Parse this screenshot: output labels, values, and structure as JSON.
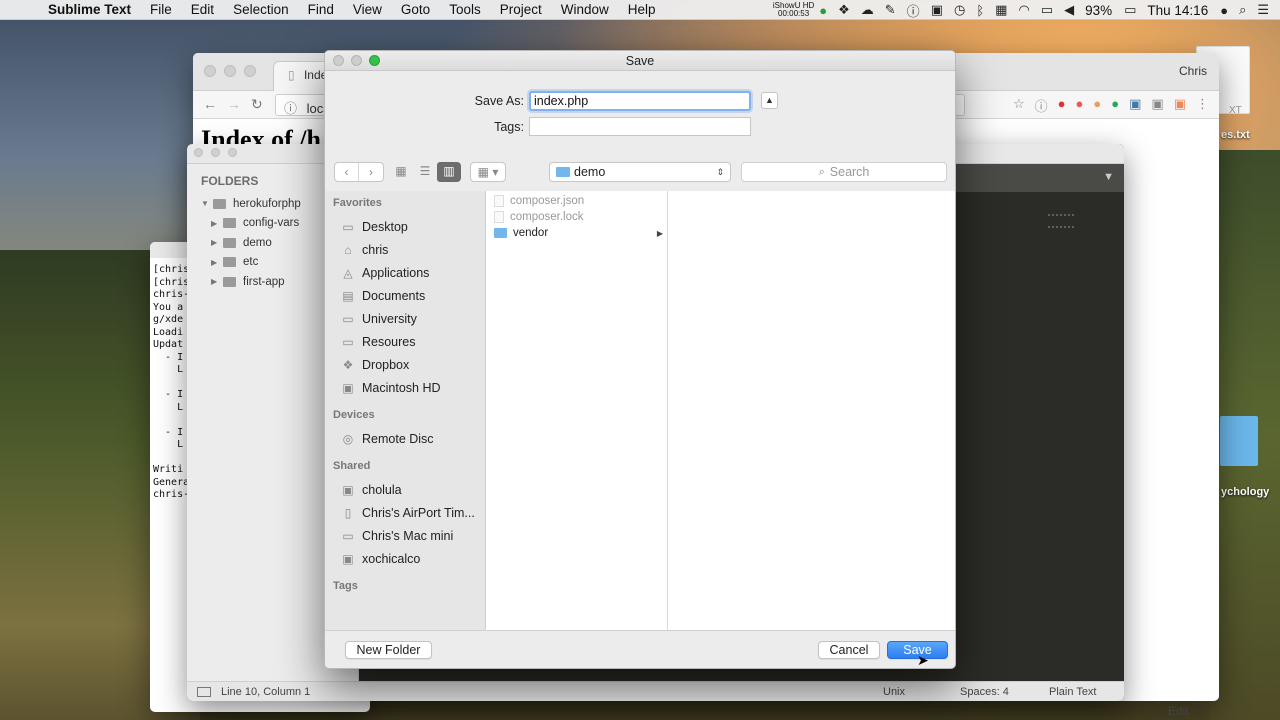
{
  "menubar": {
    "app_name": "Sublime Text",
    "menus": [
      "File",
      "Edit",
      "Selection",
      "Find",
      "View",
      "Goto",
      "Tools",
      "Project",
      "Window",
      "Help"
    ],
    "recorder_line1": "iShowU HD",
    "recorder_line2": "00:00:53",
    "battery": "93%",
    "clock": "Thu 14:16"
  },
  "browser": {
    "tab_title": "Index o",
    "user": "Chris",
    "url": "loca",
    "heading": "Index of /h"
  },
  "terminal": {
    "lines": "[chris-\n[chris-\nchris-\nYou a\ng/xde\nLoadi\nUpdat\n  - I\n    L\n\n  - I\n    L\n\n  - I\n    L\n\nWriti\nGenera\nchris-"
  },
  "sublime": {
    "sidebar_title": "FOLDERS",
    "project": "herokuforphp",
    "folders": [
      "config-vars",
      "demo",
      "etc",
      "first-app"
    ],
    "status_position": "Line 10, Column 1",
    "status_line_endings": "Unix",
    "status_indent": "Spaces: 4",
    "status_syntax": "Plain Text"
  },
  "desktop": {
    "file_label": "es.txt",
    "file_partial": "XT",
    "folder_label": "ychology",
    "edit_label": "Edit"
  },
  "dialog": {
    "title": "Save",
    "save_as_label": "Save As:",
    "save_as_value": "index.php",
    "tags_label": "Tags:",
    "location": "demo",
    "search_placeholder": "Search",
    "sidebar": {
      "favorites_title": "Favorites",
      "favorites": [
        {
          "label": "Desktop",
          "icon": "▭"
        },
        {
          "label": "chris",
          "icon": "⌂"
        },
        {
          "label": "Applications",
          "icon": "◬"
        },
        {
          "label": "Documents",
          "icon": "▤"
        },
        {
          "label": "University",
          "icon": "▭"
        },
        {
          "label": "Resoures",
          "icon": "▭"
        },
        {
          "label": "Dropbox",
          "icon": "❖"
        },
        {
          "label": "Macintosh HD",
          "icon": "▣"
        }
      ],
      "devices_title": "Devices",
      "devices": [
        {
          "label": "Remote Disc",
          "icon": "◎"
        }
      ],
      "shared_title": "Shared",
      "shared": [
        {
          "label": "cholula",
          "icon": "▣"
        },
        {
          "label": "Chris's AirPort Tim...",
          "icon": "▯"
        },
        {
          "label": "Chris's Mac mini",
          "icon": "▭"
        },
        {
          "label": "xochicalco",
          "icon": "▣"
        }
      ],
      "tags_title": "Tags"
    },
    "files": [
      {
        "name": "composer.json",
        "type": "file"
      },
      {
        "name": "composer.lock",
        "type": "file"
      },
      {
        "name": "vendor",
        "type": "folder"
      }
    ],
    "new_folder_label": "New Folder",
    "cancel_label": "Cancel",
    "save_label": "Save"
  }
}
